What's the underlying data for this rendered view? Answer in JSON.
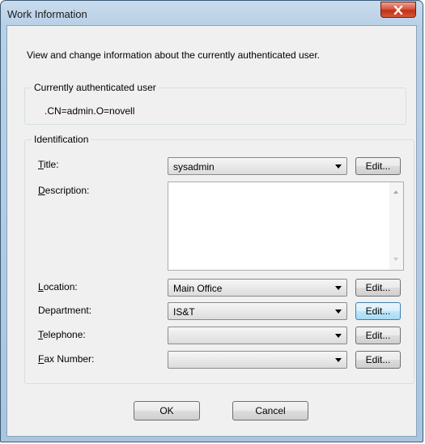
{
  "window": {
    "title": "Work Information"
  },
  "intro": "View and change information about the currently authenticated user.",
  "user_group": {
    "label": "Currently authenticated user",
    "value": ".CN=admin.O=novell"
  },
  "identification": {
    "label": "Identification",
    "title": {
      "label_key": "T",
      "label_rest": "itle:",
      "value": "sysadmin",
      "edit": "Edit..."
    },
    "description": {
      "label_key": "D",
      "label_rest": "escription:",
      "value": ""
    },
    "location": {
      "label_key": "L",
      "label_rest": "ocation:",
      "value": "Main Office",
      "edit": "Edit..."
    },
    "department": {
      "label": "Department:",
      "value": "IS&T",
      "edit": "Edit..."
    },
    "telephone": {
      "label_key": "T",
      "label_rest": "elephone:",
      "value": "",
      "edit": "Edit..."
    },
    "fax": {
      "label_key": "F",
      "label_rest": "ax Number:",
      "value": "",
      "edit": "Edit..."
    }
  },
  "buttons": {
    "ok": "OK",
    "cancel": "Cancel"
  },
  "icons": {
    "close": "close-icon",
    "dropdown": "chevron-down-icon"
  }
}
